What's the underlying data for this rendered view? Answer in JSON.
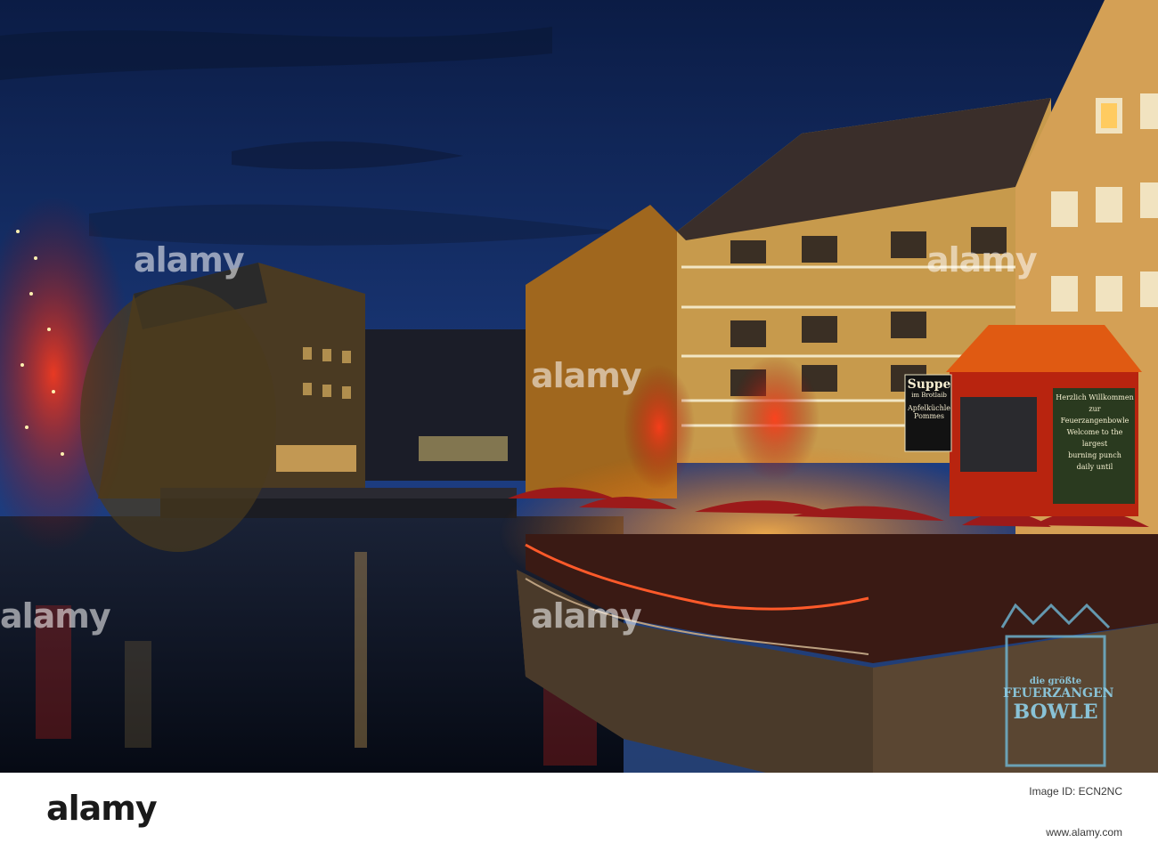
{
  "photo": {
    "description": "",
    "colors": {
      "sky_top": "#0d1f4a",
      "sky_bottom": "#1f3d7d",
      "water": "#0d1424",
      "warm_light": "#ff8a2a",
      "red_glow": "#d41a1a",
      "projection": "#6fb8d6"
    }
  },
  "signs": {
    "suppe_line1": "Suppe",
    "suppe_line2": "im Brotlaib",
    "apfel_line1": "Apfelküchle",
    "apfel_line2": "Pommes",
    "chalk_lines": [
      "Herzlich Willkommen",
      "zur",
      "Feuerzangenbowle",
      "Welcome to the largest",
      "burning punch",
      "daily until"
    ],
    "projection_lines": [
      "die größte",
      "FEUERZANGEN",
      "BOWLE"
    ]
  },
  "watermark": {
    "text": "alamy"
  },
  "footer": {
    "logo": "alamy",
    "image_id": "Image ID: ECN2NC",
    "url": "www.alamy.com"
  }
}
